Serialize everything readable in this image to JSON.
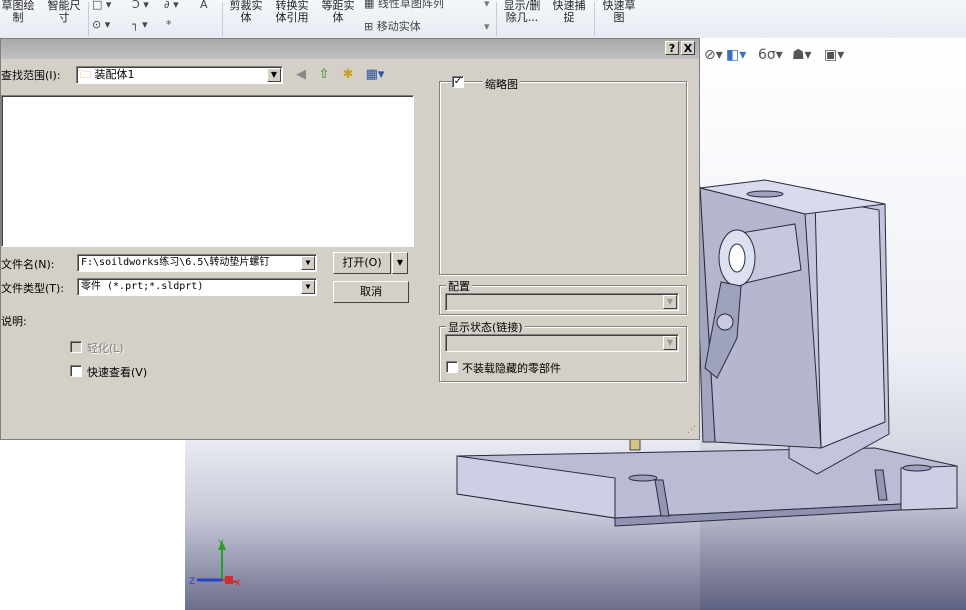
{
  "ribbon": {
    "sketch_label": "草图绘\n制",
    "smart_dim_label": "智能尺\n寸",
    "trim_label": "剪裁实\n体",
    "convert_label": "转换实\n体引用",
    "offset_label": "等距实\n体",
    "linear_pattern_label": "线性草图阵列",
    "move_entity_label": "移动实体",
    "show_delete_label": "显示/删\n除几...",
    "quick_snap_label": "快速捕\n捉",
    "quick_sketch_label": "快速草\n图"
  },
  "dialog": {
    "help_button": "?",
    "close_button": "X",
    "look_in_label": "查找范围(I):",
    "look_in_value": "装配体1",
    "filename_label": "文件名(N):",
    "filename_value": "F:\\soildworks练习\\6.5\\转动垫片螺钉",
    "filetype_label": "文件类型(T):",
    "filetype_value": "零件 (*.prt;*.sldprt)",
    "open_button": "打开(O)",
    "cancel_button": "取消",
    "description_label": "说明:",
    "lightweight_label": "轻化(L)",
    "quick_view_label": "快速查看(V)",
    "thumbnail_label": "缩略图",
    "thumbnail_checked": "✓",
    "config_label": "配置",
    "display_state_label": "显示状态(链接)",
    "no_hidden_label": "不装载隐藏的零部件"
  },
  "triad": {
    "x_label": "X",
    "y_label": "Y",
    "z_label": "Z"
  },
  "colors": {
    "dialog_bg": "#d4d0c8",
    "titlebar": "#b4b4b4",
    "part_fill": "#c8cbe0",
    "part_stroke": "#2a2a3a"
  }
}
